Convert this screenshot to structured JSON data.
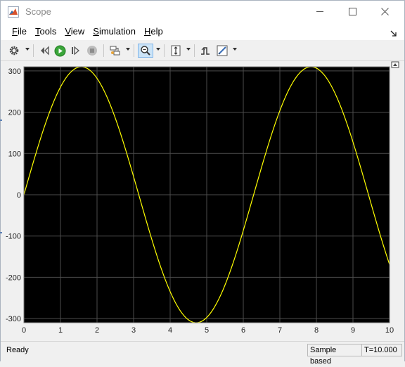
{
  "window": {
    "title": "Scope"
  },
  "menu": [
    "File",
    "Tools",
    "View",
    "Simulation",
    "Help"
  ],
  "menu_underline_first": true,
  "status": {
    "ready": "Ready",
    "mode": "Sample based",
    "time": "T=10.000"
  },
  "colors": {
    "plot_background": "#000000",
    "signal": "#ffff00",
    "grid": "#4d4d4d",
    "tick_text": "#ffffff"
  },
  "chart_data": {
    "type": "line",
    "xlim": [
      0,
      10
    ],
    "ylim": [
      -310,
      310
    ],
    "xticks": [
      0,
      1,
      2,
      3,
      4,
      5,
      6,
      7,
      8,
      9,
      10
    ],
    "yticks": [
      300,
      200,
      100,
      0,
      -100,
      -200,
      -300
    ],
    "grid": true,
    "series": [
      {
        "function": "sine",
        "amplitude": 310,
        "period": 6.2832,
        "x": [
          0,
          0.5,
          1,
          1.5,
          2,
          2.5,
          3,
          3.5,
          4,
          4.5,
          5,
          5.5,
          6,
          6.5,
          7,
          7.5,
          8,
          8.5,
          9,
          9.5,
          10
        ],
        "y": [
          0,
          149,
          261,
          309,
          282,
          186,
          44,
          -109,
          -235,
          -303,
          -297,
          -219,
          -87,
          67,
          204,
          292,
          307,
          248,
          128,
          -23,
          -169
        ]
      }
    ]
  }
}
